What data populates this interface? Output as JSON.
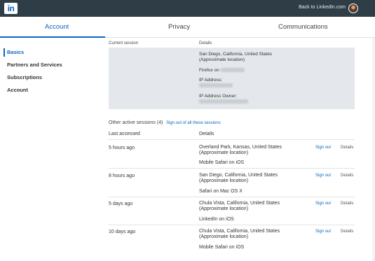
{
  "topbar": {
    "logo_text": "in",
    "back_link": "Back to LinkedIn.com"
  },
  "tabs": [
    {
      "label": "Account",
      "active": true
    },
    {
      "label": "Privacy",
      "active": false
    },
    {
      "label": "Communications",
      "active": false
    }
  ],
  "sidebar": {
    "items": [
      {
        "label": "Basics",
        "active": true
      },
      {
        "label": "Partners and Services"
      },
      {
        "label": "Subscriptions"
      },
      {
        "label": "Account"
      }
    ]
  },
  "current": {
    "col_session": "Current session",
    "col_details": "Details",
    "location_line1": "San Diego, California, United States",
    "location_line2": "(Approximate location)",
    "browser_prefix": "Firefox on",
    "ip_label": "IP Address:",
    "ip_owner_label": "IP Address Owner:"
  },
  "other": {
    "title": "Other active sessions (4)",
    "signout_all": "Sign out of all these sessions",
    "col_last": "Last accessed",
    "col_details": "Details",
    "signout_label": "Sign out",
    "details_label": "Details",
    "rows": [
      {
        "time": "5 hours ago",
        "loc1": "Overland Park, Kansas, United States",
        "loc2": "(Approximate location)",
        "browser": "Mobile Safari on iOS"
      },
      {
        "time": "8 hours ago",
        "loc1": "San Diego, California, United States",
        "loc2": "(Approximate location)",
        "browser": "Safari on Mac OS X"
      },
      {
        "time": "5 days ago",
        "loc1": "Chula Vista, California, United States",
        "loc2": "(Approximate location)",
        "browser": "LinkedIn on iOS"
      },
      {
        "time": "10 days ago",
        "loc1": "Chula Vista, California, United States",
        "loc2": "(Approximate location)",
        "browser": "Mobile Safari on iOS"
      }
    ]
  }
}
